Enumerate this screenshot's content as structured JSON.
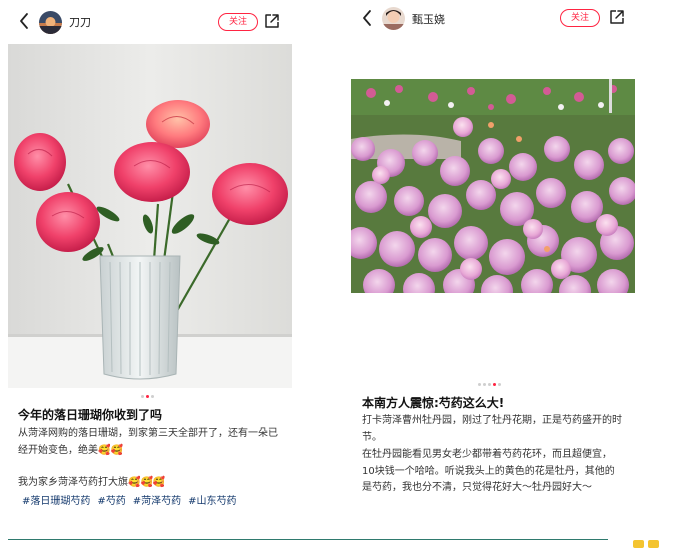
{
  "left_post": {
    "username": "刀刀",
    "follow_label": "关注",
    "title": "今年的落日珊瑚你收到了吗",
    "body": "从菏泽网购的落日珊瑚，到家第三天全部开了，还有一朵已经开始变色，绝美🥰🥰",
    "promo": "我为家乡菏泽芍药打大旗🥰🥰🥰",
    "tags": [
      "#落日珊瑚芍药",
      "#芍药",
      "#菏泽芍药",
      "#山东芍药"
    ],
    "carousel": {
      "count": 3,
      "active": 1
    }
  },
  "right_post": {
    "username": "甄玉娆",
    "follow_label": "关注",
    "title": "本南方人震惊:芍药这么大!",
    "body_line1": "打卡菏泽曹州牡丹园，刚过了牡丹花期，正是芍药盛开的时节。",
    "body_line2": "在牡丹园能看见男女老少都带着芍药花环，而且超便宜，10块钱一个哈哈。听说我头上的黄色的花是牡丹，其他的是芍药，我也分不清，只觉得花好大～牡丹园好大～",
    "carousel": {
      "count": 5,
      "active": 3
    }
  },
  "icons": [
    "back-arrow-icon",
    "share-icon"
  ],
  "colors": {
    "accent": "#ff2442",
    "tag": "#13386c",
    "divider": "#2f7a6e",
    "badge": "#f4c430"
  }
}
